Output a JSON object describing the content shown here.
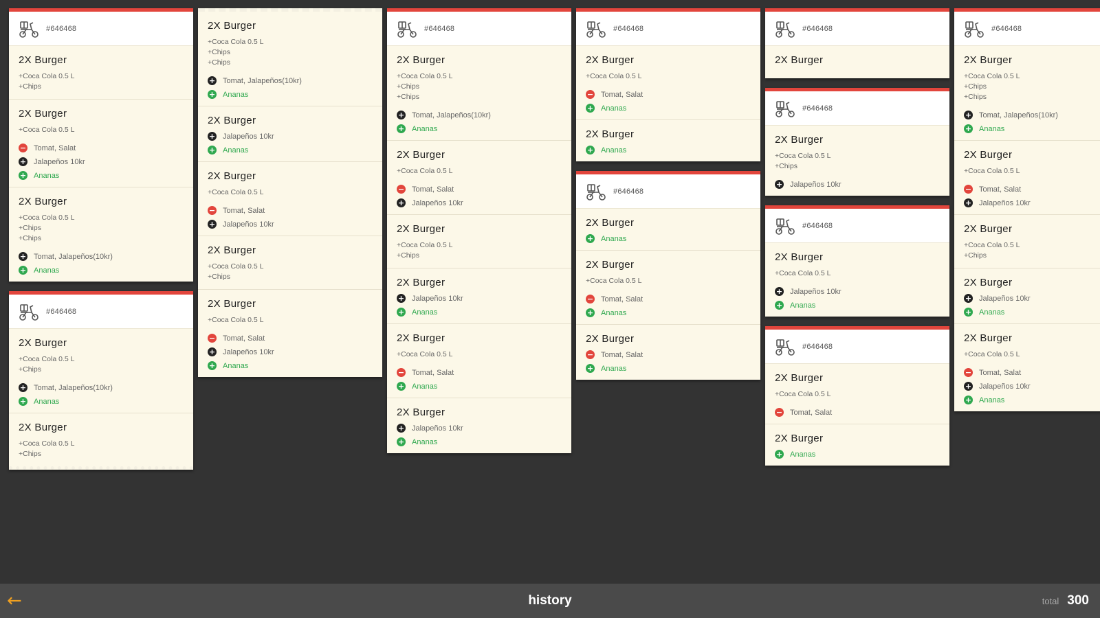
{
  "footer": {
    "back_icon": "arrow-left-icon",
    "title": "history",
    "total_label": "total",
    "total_value": "300"
  },
  "colors": {
    "background": "#333333",
    "ticket": "#fcf8e8",
    "accent_red": "#e2453c",
    "add_green": "#2fa84f",
    "back_arrow": "#f0a020",
    "footer": "#4a4a4a"
  },
  "columns": [
    {
      "tickets": [
        {
          "header": true,
          "order_no": "#646468",
          "items": [
            {
              "title": "2X  Burger",
              "extras": [
                "+Coca Cola 0.5 L",
                "+Chips"
              ],
              "mods": []
            },
            {
              "title": "2X  Burger",
              "extras": [
                "+Coca Cola 0.5 L"
              ],
              "mods": [
                {
                  "kind": "remove",
                  "text": "Tomat,  Salat"
                },
                {
                  "kind": "change",
                  "text": "Jalapeños  10kr"
                },
                {
                  "kind": "add",
                  "text": "Ananas"
                }
              ]
            },
            {
              "title": "2X  Burger",
              "extras": [
                "+Coca Cola 0.5 L",
                "+Chips",
                "+Chips"
              ],
              "mods": [
                {
                  "kind": "change",
                  "text": "Tomat,   Jalapeños(10kr)"
                },
                {
                  "kind": "add",
                  "text": "Ananas"
                }
              ]
            }
          ]
        },
        {
          "header": true,
          "torn_bottom": true,
          "order_no": "#646468",
          "items": [
            {
              "title": "2X  Burger",
              "extras": [
                "+Coca Cola 0.5 L",
                "+Chips"
              ],
              "mods": [
                {
                  "kind": "change",
                  "text": "Tomat,   Jalapeños(10kr)"
                },
                {
                  "kind": "add",
                  "text": "Ananas"
                }
              ]
            },
            {
              "title": "2X  Burger",
              "extras": [
                "+Coca Cola 0.5 L",
                "+Chips"
              ],
              "mods": []
            }
          ]
        }
      ]
    },
    {
      "tickets": [
        {
          "header": false,
          "order_no": "",
          "items": [
            {
              "title": "2X  Burger",
              "extras": [
                "+Coca Cola 0.5 L",
                "+Chips",
                "+Chips"
              ],
              "mods": [
                {
                  "kind": "change",
                  "text": "Tomat,   Jalapeños(10kr)"
                },
                {
                  "kind": "add",
                  "text": "Ananas"
                }
              ]
            },
            {
              "title": "2X  Burger",
              "extras": [],
              "mods": [
                {
                  "kind": "change",
                  "text": "Jalapeños  10kr"
                },
                {
                  "kind": "add",
                  "text": "Ananas"
                }
              ]
            },
            {
              "title": "2X  Burger",
              "extras": [
                "+Coca Cola 0.5 L"
              ],
              "mods": [
                {
                  "kind": "remove",
                  "text": "Tomat,  Salat"
                },
                {
                  "kind": "change",
                  "text": "Jalapeños  10kr"
                }
              ]
            },
            {
              "title": "2X  Burger",
              "extras": [
                "+Coca Cola 0.5 L",
                "+Chips"
              ],
              "mods": []
            },
            {
              "title": "2X  Burger",
              "extras": [
                "+Coca Cola 0.5 L"
              ],
              "mods": [
                {
                  "kind": "remove",
                  "text": "Tomat,  Salat"
                },
                {
                  "kind": "change",
                  "text": "Jalapeños  10kr"
                },
                {
                  "kind": "add",
                  "text": "Ananas"
                }
              ]
            }
          ]
        }
      ]
    },
    {
      "tickets": [
        {
          "header": true,
          "order_no": "#646468",
          "items": [
            {
              "title": "2X  Burger",
              "extras": [
                "+Coca Cola 0.5 L",
                "+Chips",
                "+Chips"
              ],
              "mods": [
                {
                  "kind": "change",
                  "text": "Tomat,   Jalapeños(10kr)"
                },
                {
                  "kind": "add",
                  "text": "Ananas"
                }
              ]
            },
            {
              "title": "2X  Burger",
              "extras": [
                "+Coca Cola 0.5 L"
              ],
              "mods": [
                {
                  "kind": "remove",
                  "text": "Tomat,  Salat"
                },
                {
                  "kind": "change",
                  "text": "Jalapeños  10kr"
                }
              ]
            },
            {
              "title": "2X  Burger",
              "extras": [
                "+Coca Cola 0.5 L",
                "+Chips"
              ],
              "mods": []
            },
            {
              "title": "2X  Burger",
              "extras": [],
              "mods": [
                {
                  "kind": "change",
                  "text": "Jalapeños  10kr"
                },
                {
                  "kind": "add",
                  "text": "Ananas"
                }
              ]
            },
            {
              "title": "2X  Burger",
              "extras": [
                "+Coca Cola 0.5 L"
              ],
              "mods": [
                {
                  "kind": "remove",
                  "text": "Tomat,  Salat"
                },
                {
                  "kind": "add",
                  "text": "Ananas"
                }
              ]
            },
            {
              "title": "2X  Burger",
              "extras": [],
              "mods": [
                {
                  "kind": "change",
                  "text": "Jalapeños  10kr"
                },
                {
                  "kind": "add",
                  "text": "Ananas"
                }
              ]
            }
          ]
        }
      ]
    },
    {
      "tickets": [
        {
          "header": true,
          "order_no": "#646468",
          "items": [
            {
              "title": "2X  Burger",
              "extras": [
                "+Coca Cola 0.5 L"
              ],
              "mods": [
                {
                  "kind": "remove",
                  "text": "Tomat,  Salat"
                },
                {
                  "kind": "add",
                  "text": "Ananas"
                }
              ]
            },
            {
              "title": "2X  Burger",
              "extras": [],
              "mods": [
                {
                  "kind": "add",
                  "text": "Ananas"
                }
              ]
            }
          ]
        },
        {
          "header": true,
          "order_no": "#646468",
          "items": [
            {
              "title": "2X  Burger",
              "extras": [],
              "mods": [
                {
                  "kind": "add",
                  "text": "Ananas"
                }
              ]
            },
            {
              "title": "2X  Burger",
              "extras": [
                "+Coca Cola 0.5 L"
              ],
              "mods": [
                {
                  "kind": "remove",
                  "text": "Tomat,  Salat"
                },
                {
                  "kind": "add",
                  "text": "Ananas"
                }
              ]
            },
            {
              "title": "2X  Burger",
              "extras": [],
              "mods": [
                {
                  "kind": "remove",
                  "text": "Tomat,  Salat"
                },
                {
                  "kind": "add",
                  "text": "Ananas"
                }
              ]
            }
          ]
        }
      ]
    },
    {
      "tickets": [
        {
          "header": true,
          "order_no": "#646468",
          "items": [
            {
              "title": "2X  Burger",
              "extras": [],
              "mods": []
            }
          ]
        },
        {
          "header": true,
          "order_no": "#646468",
          "items": [
            {
              "title": "2X  Burger",
              "extras": [
                "+Coca Cola 0.5 L",
                "+Chips"
              ],
              "mods": [
                {
                  "kind": "change",
                  "text": "Jalapeños  10kr"
                }
              ]
            }
          ]
        },
        {
          "header": true,
          "order_no": "#646468",
          "items": [
            {
              "title": "2X  Burger",
              "extras": [
                "+Coca Cola 0.5 L"
              ],
              "mods": [
                {
                  "kind": "change",
                  "text": "Jalapeños  10kr"
                },
                {
                  "kind": "add",
                  "text": "Ananas"
                }
              ]
            }
          ]
        },
        {
          "header": true,
          "order_no": "#646468",
          "items": [
            {
              "title": "2X  Burger",
              "extras": [
                "+Coca Cola 0.5 L"
              ],
              "mods": [
                {
                  "kind": "remove",
                  "text": "Tomat,  Salat"
                }
              ]
            },
            {
              "title": "2X  Burger",
              "extras": [],
              "mods": [
                {
                  "kind": "add",
                  "text": "Ananas"
                }
              ]
            }
          ]
        }
      ]
    },
    {
      "tickets": [
        {
          "header": true,
          "order_no": "#646468",
          "items": [
            {
              "title": "2X  Burger",
              "extras": [
                "+Coca Cola 0.5 L",
                "+Chips",
                "+Chips"
              ],
              "mods": [
                {
                  "kind": "change",
                  "text": "Tomat,   Jalapeños(10kr)"
                },
                {
                  "kind": "add",
                  "text": "Ananas"
                }
              ]
            },
            {
              "title": "2X  Burger",
              "extras": [
                "+Coca Cola 0.5 L"
              ],
              "mods": [
                {
                  "kind": "remove",
                  "text": "Tomat,  Salat"
                },
                {
                  "kind": "change",
                  "text": "Jalapeños  10kr"
                }
              ]
            },
            {
              "title": "2X  Burger",
              "extras": [
                "+Coca Cola 0.5 L",
                "+Chips"
              ],
              "mods": []
            },
            {
              "title": "2X  Burger",
              "extras": [],
              "mods": [
                {
                  "kind": "change",
                  "text": "Jalapeños  10kr"
                },
                {
                  "kind": "add",
                  "text": "Ananas"
                }
              ]
            },
            {
              "title": "2X  Burger",
              "extras": [
                "+Coca Cola 0.5 L"
              ],
              "mods": [
                {
                  "kind": "remove",
                  "text": "Tomat,  Salat"
                },
                {
                  "kind": "change",
                  "text": "Jalapeños  10kr"
                },
                {
                  "kind": "add",
                  "text": "Ananas"
                }
              ]
            }
          ]
        }
      ]
    }
  ]
}
